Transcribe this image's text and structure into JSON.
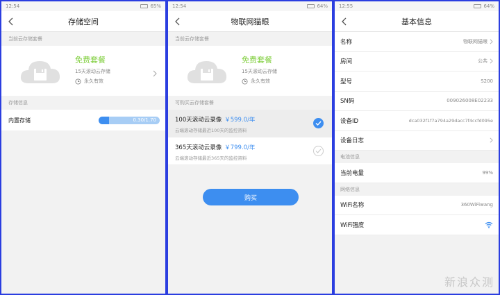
{
  "screen1": {
    "status_time": "12:54",
    "status_battery": "65%",
    "title": "存储空间",
    "section_current": "当前云存储套餐",
    "plan": {
      "name": "免费套餐",
      "desc": "15天滚动云存储",
      "validity": "永久有效"
    },
    "section_storage": "存储信息",
    "storage": {
      "label": "内置存储",
      "usage_text": "0.30/1.70",
      "used_fraction": 0.176
    }
  },
  "screen2": {
    "status_time": "12:54",
    "status_battery": "64%",
    "title": "物联网猫眼",
    "section_current": "当前云存储套餐",
    "plan": {
      "name": "免费套餐",
      "desc": "15天滚动云存储",
      "validity": "永久有效"
    },
    "section_buy": "可购买云存储套餐",
    "packages": [
      {
        "name": "100天滚动云录像",
        "price": "￥599.0/年",
        "desc": "云端滚动存储最近100天的监控资料",
        "selected": true
      },
      {
        "name": "365天滚动云录像",
        "price": "￥799.0/年",
        "desc": "云端滚动存储最近365天的监控资料",
        "selected": false
      }
    ],
    "buy_button": "购买"
  },
  "screen3": {
    "status_time": "12:55",
    "status_battery": "64%",
    "title": "基本信息",
    "rows_basic": [
      {
        "key": "名称",
        "value": "物联网猫眼",
        "arrow": true
      },
      {
        "key": "房间",
        "value": "公共",
        "arrow": true
      },
      {
        "key": "型号",
        "value": "S200",
        "arrow": false
      },
      {
        "key": "SN码",
        "value": "009026008E02233",
        "arrow": false
      },
      {
        "key": "设备ID",
        "value": "dca032f1f7a794a29dacc7f4ccfd095e",
        "arrow": false
      },
      {
        "key": "设备日志",
        "value": "",
        "arrow": true
      }
    ],
    "section_battery": "电池信息",
    "battery_row": {
      "key": "当前电量",
      "value": "99%"
    },
    "section_network": "网络信息",
    "wifi_name_row": {
      "key": "WiFi名称",
      "value": "360WiFiwang"
    },
    "wifi_strength_row": {
      "key": "WiFi强度",
      "icon": "wifi-icon"
    }
  },
  "watermark": "新浪众测",
  "colors": {
    "accent": "#3d8ef0",
    "plan_green": "#7fce3c",
    "frame": "#2b3ee0"
  }
}
